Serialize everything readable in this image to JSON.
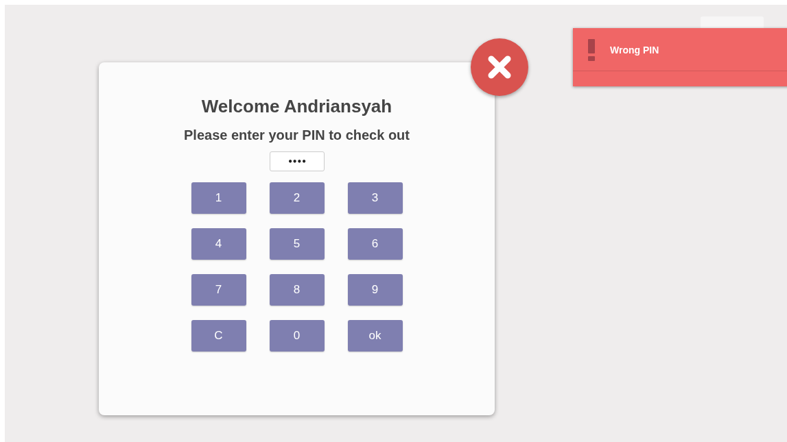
{
  "dialog": {
    "title": "Welcome Andriansyah",
    "prompt": "Please enter your PIN to check out",
    "pin_field": {
      "value": "••••"
    },
    "keys": [
      "1",
      "2",
      "3",
      "4",
      "5",
      "6",
      "7",
      "8",
      "9",
      "C",
      "0",
      "ok"
    ]
  },
  "notification": {
    "kind": "error",
    "message": "Wrong PIN"
  }
}
